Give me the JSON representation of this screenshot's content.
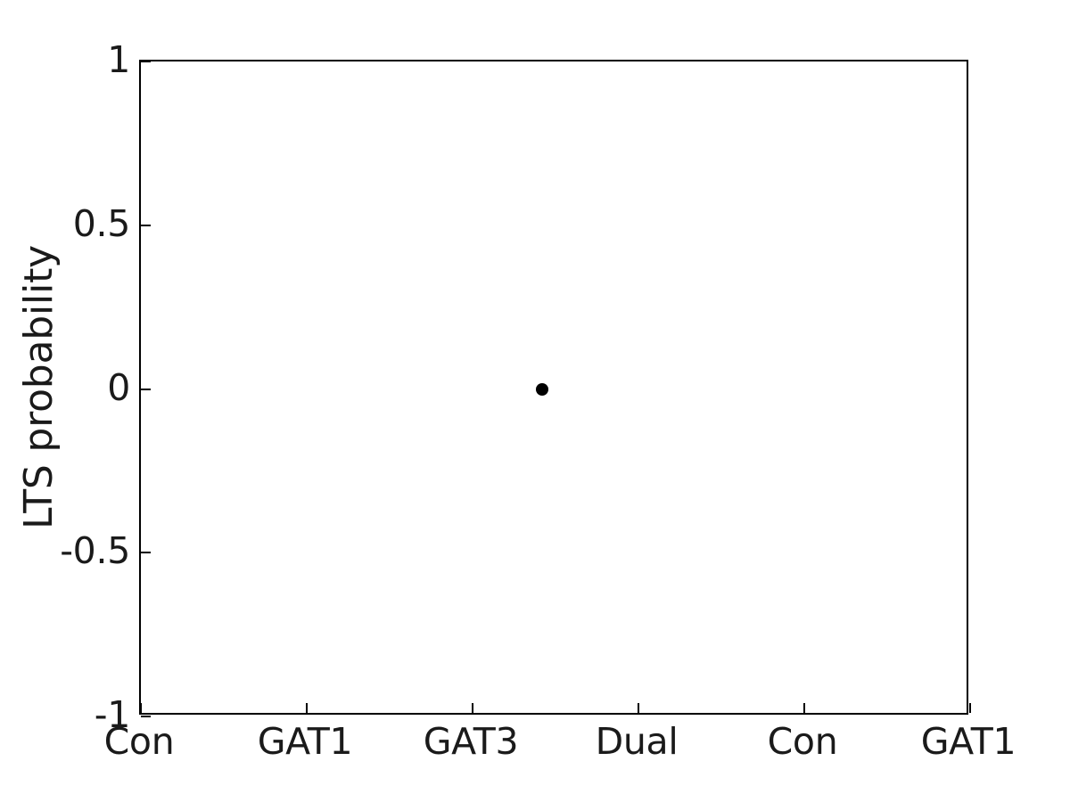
{
  "chart_data": {
    "type": "scatter",
    "title": "",
    "xlabel": "",
    "ylabel": "LTS probability",
    "xlim": [
      0.5,
      6.5
    ],
    "ylim": [
      -1,
      1
    ],
    "grid": false,
    "legend": null,
    "categories": [
      "Con",
      "GAT1",
      "GAT3",
      "Dual",
      "Con",
      "GAT1"
    ],
    "xtick_positions": [
      1,
      2,
      3,
      4,
      5,
      6
    ],
    "xtick_labels": [
      "Con",
      "GAT1",
      "GAT3",
      "Dual",
      "Con",
      "GAT1"
    ],
    "ytick_positions": [
      1,
      0.5,
      0,
      -0.5,
      -1
    ],
    "ytick_labels": [
      "1",
      "0.5",
      "0",
      "-0.5",
      "-1"
    ],
    "series": [
      {
        "name": "LTS probability",
        "marker": "filled-circle",
        "color": "#000000",
        "marker_size": 14,
        "points": [
          {
            "x": 3.4,
            "y": 0,
            "x_category": "GAT3",
            "label": "0"
          }
        ]
      }
    ]
  },
  "axes": {
    "box_color": "#000000",
    "tick_color": "#000000",
    "text_color": "#1a1a1a",
    "background": "#ffffff"
  }
}
